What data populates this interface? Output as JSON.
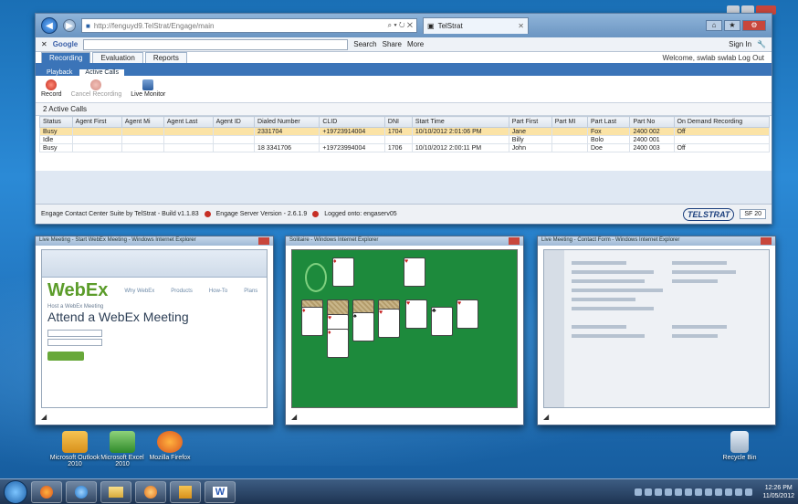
{
  "browser": {
    "address": "http://fenguyd9.TelStrat/Engage/main",
    "tab_title": "TelStrat",
    "toolbar": {
      "google": "Google",
      "search_label": "Search",
      "share_label": "Share",
      "more_label": "More",
      "signin_label": "Sign In"
    }
  },
  "app": {
    "tabs": [
      "Recording",
      "Evaluation",
      "Reports"
    ],
    "welcome": "Welcome, swlab swlab Log Out",
    "subtabs": [
      "Playback",
      "Active Calls"
    ],
    "actions": [
      {
        "label": "Record",
        "enabled": true
      },
      {
        "label": "Cancel Recording",
        "enabled": false
      },
      {
        "label": "Live Monitor",
        "enabled": true
      }
    ],
    "section_title": "2 Active Calls",
    "columns": [
      "Status",
      "Agent First",
      "Agent Mi",
      "Agent Last",
      "Agent ID",
      "Dialed Number",
      "CLID",
      "DNI",
      "Start Time",
      "Part First",
      "Part MI",
      "Part Last",
      "Part No",
      "On Demand Recording"
    ],
    "rows": [
      [
        "Busy",
        "",
        "",
        "",
        "",
        "2331704",
        "+19723914004",
        "1704",
        "10/10/2012 2:01:06 PM",
        "Jane",
        "",
        "Fox",
        "2400 002",
        "Off"
      ],
      [
        "Idle",
        "",
        "",
        "",
        "",
        "",
        "",
        "",
        "",
        "Billy",
        "",
        "Bolo",
        "2400 001",
        ""
      ],
      [
        "Busy",
        "",
        "",
        "",
        "",
        "18 3341706",
        "+19723994004",
        "1706",
        "10/10/2012 2:00:11 PM",
        "John",
        "",
        "Doe",
        "2400 003",
        "Off"
      ]
    ],
    "status": {
      "build": "Engage Contact Center Suite by TelStrat - Build v1.1.83",
      "server": "Engage Server Version - 2.6.1.9",
      "logged": "Logged onto: engaserv05",
      "logo": "TELSTRAT",
      "version_btn": "SF 20"
    }
  },
  "thumbnails": [
    {
      "title": "Live Meeting - Start WebEx Meeting - Windows Internet Explorer",
      "brand": "WebEx",
      "nav": [
        "Why WebEx",
        "Products",
        "How-To",
        "Plans"
      ],
      "sub": "Host a WebEx Meeting",
      "heading": "Attend a WebEx Meeting"
    },
    {
      "title": "Solitaire - Windows Internet Explorer",
      "brand": "",
      "nav": [],
      "sub": "",
      "heading": ""
    },
    {
      "title": "Live Meeting - Contact Form - Windows Internet Explorer",
      "brand": "",
      "nav": [],
      "sub": "",
      "heading": ""
    }
  ],
  "desktop_icons": [
    {
      "label": "Microsoft Outlook 2010"
    },
    {
      "label": "Microsoft Excel 2010"
    },
    {
      "label": "Mozilla Firefox"
    },
    {
      "label": "Recycle Bin"
    }
  ],
  "taskbar": {
    "items": [
      "firefox",
      "ie",
      "explorer",
      "media",
      "outlook",
      "word"
    ],
    "word_glyph": "W",
    "time": "12:26 PM",
    "date": "11/05/2012"
  },
  "colors": {
    "accent": "#3b74b8",
    "selected_row": "#fbe3a6",
    "solitaire_green": "#1d8a3c"
  }
}
